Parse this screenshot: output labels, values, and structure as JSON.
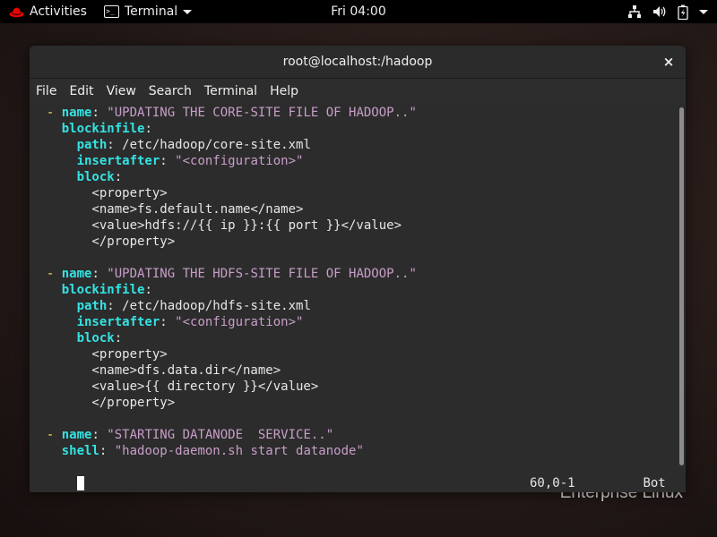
{
  "topbar": {
    "activities": "Activities",
    "app_name": "Terminal",
    "clock": "Fri 04:00",
    "icons": [
      "network-wired-icon",
      "volume-icon",
      "battery-icon",
      "power-menu-arrow-icon"
    ]
  },
  "desktop": {
    "watermark": "Enterprise Linux"
  },
  "window": {
    "title": "root@localhost:/hadoop",
    "close_glyph": "×",
    "menu": [
      "File",
      "Edit",
      "View",
      "Search",
      "Terminal",
      "Help"
    ]
  },
  "editor": {
    "lines": [
      [
        {
          "t": "  ",
          "c": ""
        },
        {
          "t": "- ",
          "c": "d"
        },
        {
          "t": "name",
          "c": "k"
        },
        {
          "t": ": ",
          "c": ""
        },
        {
          "t": "\"UPDATING THE CORE-SITE FILE OF HADOOP..\"",
          "c": "s"
        }
      ],
      [
        {
          "t": "    ",
          "c": ""
        },
        {
          "t": "blockinfile",
          "c": "k"
        },
        {
          "t": ":",
          "c": ""
        }
      ],
      [
        {
          "t": "      ",
          "c": ""
        },
        {
          "t": "path",
          "c": "k"
        },
        {
          "t": ": /etc/hadoop/core-site.xml",
          "c": ""
        }
      ],
      [
        {
          "t": "      ",
          "c": ""
        },
        {
          "t": "insertafter",
          "c": "k"
        },
        {
          "t": ": ",
          "c": ""
        },
        {
          "t": "\"<configuration>\"",
          "c": "s"
        }
      ],
      [
        {
          "t": "      ",
          "c": ""
        },
        {
          "t": "block",
          "c": "k"
        },
        {
          "t": ":",
          "c": ""
        }
      ],
      [
        {
          "t": "        <property>",
          "c": ""
        }
      ],
      [
        {
          "t": "        <name>fs.default.name</name>",
          "c": ""
        }
      ],
      [
        {
          "t": "        <value>hdfs://{{ ip }}:{{ port }}</value>",
          "c": ""
        }
      ],
      [
        {
          "t": "        </property>",
          "c": ""
        }
      ],
      [
        {
          "t": "",
          "c": ""
        }
      ],
      [
        {
          "t": "  ",
          "c": ""
        },
        {
          "t": "- ",
          "c": "d"
        },
        {
          "t": "name",
          "c": "k"
        },
        {
          "t": ": ",
          "c": ""
        },
        {
          "t": "\"UPDATING THE HDFS-SITE FILE OF HADOOP..\"",
          "c": "s"
        }
      ],
      [
        {
          "t": "    ",
          "c": ""
        },
        {
          "t": "blockinfile",
          "c": "k"
        },
        {
          "t": ":",
          "c": ""
        }
      ],
      [
        {
          "t": "      ",
          "c": ""
        },
        {
          "t": "path",
          "c": "k"
        },
        {
          "t": ": /etc/hadoop/hdfs-site.xml",
          "c": ""
        }
      ],
      [
        {
          "t": "      ",
          "c": ""
        },
        {
          "t": "insertafter",
          "c": "k"
        },
        {
          "t": ": ",
          "c": ""
        },
        {
          "t": "\"<configuration>\"",
          "c": "s"
        }
      ],
      [
        {
          "t": "      ",
          "c": ""
        },
        {
          "t": "block",
          "c": "k"
        },
        {
          "t": ":",
          "c": ""
        }
      ],
      [
        {
          "t": "        <property>",
          "c": ""
        }
      ],
      [
        {
          "t": "        <name>dfs.data.dir</name>",
          "c": ""
        }
      ],
      [
        {
          "t": "        <value>{{ directory }}</value>",
          "c": ""
        }
      ],
      [
        {
          "t": "        </property>",
          "c": ""
        }
      ],
      [
        {
          "t": "",
          "c": ""
        }
      ],
      [
        {
          "t": "  ",
          "c": ""
        },
        {
          "t": "- ",
          "c": "d"
        },
        {
          "t": "name",
          "c": "k"
        },
        {
          "t": ": ",
          "c": ""
        },
        {
          "t": "\"STARTING DATANODE  SERVICE..\"",
          "c": "s"
        }
      ],
      [
        {
          "t": "    ",
          "c": ""
        },
        {
          "t": "shell",
          "c": "k"
        },
        {
          "t": ": ",
          "c": ""
        },
        {
          "t": "\"hadoop-daemon.sh start datanode\"",
          "c": "s"
        }
      ]
    ],
    "cursor_position": "60,0-1",
    "scroll_indicator": "Bot"
  },
  "colors": {
    "yaml_key": "#34e2e2",
    "yaml_string": "#c89ec8",
    "list_dash": "#fce94f",
    "terminal_bg": "#2c2c2c",
    "topbar_bg": "#000000"
  }
}
